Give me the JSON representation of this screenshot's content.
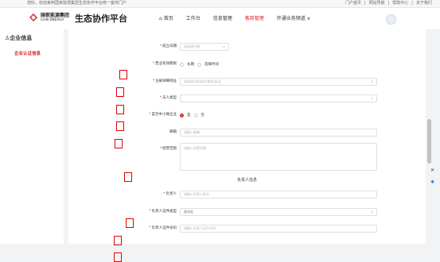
{
  "topbar": {
    "welcome": "您好，欢迎来到国家能源集团生态协作平台统一客商门户",
    "links": [
      "门户首页",
      "|",
      "网站导航",
      "|",
      "帮助中心",
      "|",
      "关于我们"
    ]
  },
  "header": {
    "logo_cn": "国家能源集团",
    "logo_en": "CHN ENERGY",
    "platform": "生态协作平台",
    "nav": [
      "首页",
      "工作台",
      "信息管理",
      "客商管理",
      "开通业务频道 ∨"
    ],
    "active_nav": "客商管理"
  },
  "sidebar": {
    "title": "企业信息",
    "item": "企业认证信息"
  },
  "form": {
    "establish_date": {
      "label": "成立日期",
      "placeholder": "请选择日期"
    },
    "valid_period": {
      "label": "营业有效期限",
      "options": [
        "长期",
        "选择时间"
      ]
    },
    "reg_address": {
      "label": "注册详细地址",
      "placeholder": "请选择注册省份/城市/区县"
    },
    "legal_type": {
      "label": "法人类型",
      "placeholder": ""
    },
    "sme": {
      "label": "是否中小微企业",
      "options": [
        "是",
        "否"
      ]
    },
    "email": {
      "label": "邮箱",
      "placeholder": "请输入邮箱"
    },
    "scope": {
      "label": "经营范围",
      "placeholder": "请输入经营范围"
    },
    "section_title": "负责人信息",
    "person": {
      "label": "负责人",
      "placeholder": "请输入负责人姓名"
    },
    "id_type": {
      "label": "负责人证件类型",
      "value": "身份证"
    },
    "id_number": {
      "label": "负责人证件号码",
      "placeholder": "请输入负责人证件号码"
    }
  }
}
